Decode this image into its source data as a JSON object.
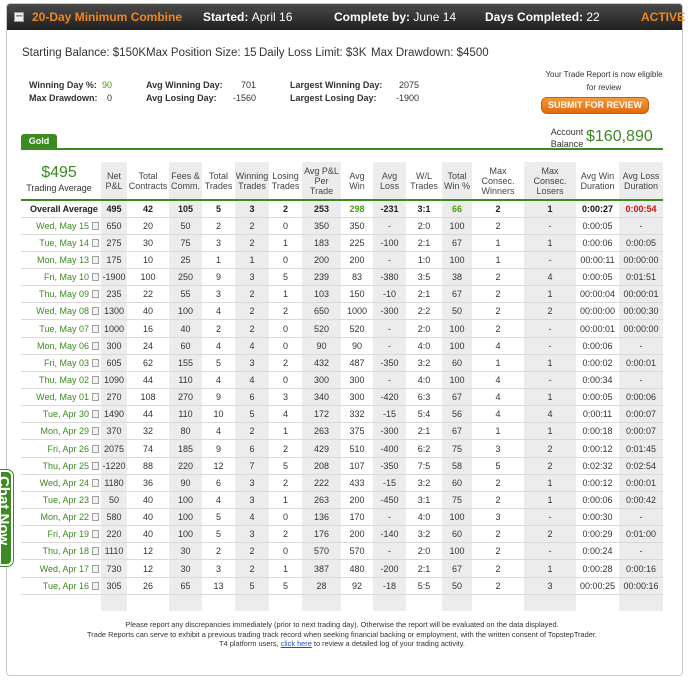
{
  "header": {
    "toggle": "−",
    "combine": "20-Day Minimum Combine",
    "started_label": "Started:",
    "started_value": "April 16",
    "complete_label": "Complete by:",
    "complete_value": "June 14",
    "days_label": "Days Completed:",
    "days_value": "22",
    "status": "ACTIVE"
  },
  "summary": {
    "starting_balance": "Starting Balance: $150K",
    "max_position": "Max Position Size: 15",
    "daily_loss": "Daily Loss Limit: $3K",
    "max_drawdown": "Max Drawdown: $4500"
  },
  "stats": {
    "winning_day_pct_label": "Winning Day %:",
    "winning_day_pct": "90",
    "max_drawdown_label": "Max Drawdown:",
    "max_drawdown": "0",
    "avg_winning_day_label": "Avg Winning Day:",
    "avg_winning_day": "701",
    "avg_losing_day_label": "Avg Losing Day:",
    "avg_losing_day": "-1560",
    "largest_winning_day_label": "Largest Winning Day:",
    "largest_winning_day": "2075",
    "largest_losing_day_label": "Largest Losing Day:",
    "largest_losing_day": "-1900"
  },
  "report": {
    "note": "Your Trade Report is now eligible for review",
    "submit_label": "SUBMIT FOR REVIEW"
  },
  "account": {
    "tab": "Gold",
    "balance_label": "Account Balance",
    "balance_value": "$160,890",
    "trading_average_value": "$495",
    "trading_average_label": "Trading Average"
  },
  "columns": [
    "Net P&L",
    "Total Contracts",
    "Fees & Comm.",
    "Total Trades",
    "Winning Trades",
    "Losing Trades",
    "Avg P&L Per Trade",
    "Avg Win",
    "Avg Loss",
    "W/L Trades",
    "Total Win %",
    "Max Consec. Winners",
    "Max Consec. Losers",
    "Avg Win Duration",
    "Avg Loss Duration"
  ],
  "overall": [
    "Overall Average",
    "495",
    "42",
    "105",
    "5",
    "3",
    "2",
    "253",
    "298",
    "-231",
    "3:1",
    "66",
    "2",
    "1",
    "0:00:27",
    "0:00:54"
  ],
  "rows": [
    [
      "Wed, May 15",
      "650",
      "20",
      "50",
      "2",
      "2",
      "0",
      "350",
      "350",
      "-",
      "2:0",
      "100",
      "2",
      "-",
      "0:00:05",
      "-"
    ],
    [
      "Tue, May 14",
      "275",
      "30",
      "75",
      "3",
      "2",
      "1",
      "183",
      "225",
      "-100",
      "2:1",
      "67",
      "1",
      "1",
      "0:00:06",
      "0:00:05"
    ],
    [
      "Mon, May 13",
      "175",
      "10",
      "25",
      "1",
      "1",
      "0",
      "200",
      "200",
      "-",
      "1:0",
      "100",
      "1",
      "-",
      "00:00:11",
      "00:00:00"
    ],
    [
      "Fri, May 10",
      "-1900",
      "100",
      "250",
      "9",
      "3",
      "5",
      "239",
      "83",
      "-380",
      "3:5",
      "38",
      "2",
      "4",
      "0:00:05",
      "0:01:51"
    ],
    [
      "Thu, May 09",
      "235",
      "22",
      "55",
      "3",
      "2",
      "1",
      "103",
      "150",
      "-10",
      "2:1",
      "67",
      "2",
      "1",
      "00:00:04",
      "00:00:01"
    ],
    [
      "Wed, May 08",
      "1300",
      "40",
      "100",
      "4",
      "2",
      "2",
      "650",
      "1000",
      "-300",
      "2:2",
      "50",
      "2",
      "2",
      "00:00:00",
      "00:00:30"
    ],
    [
      "Tue, May 07",
      "1000",
      "16",
      "40",
      "2",
      "2",
      "0",
      "520",
      "520",
      "-",
      "2:0",
      "100",
      "2",
      "-",
      "00:00:01",
      "00:00:00"
    ],
    [
      "Mon, May 06",
      "300",
      "24",
      "60",
      "4",
      "4",
      "0",
      "90",
      "90",
      "-",
      "4:0",
      "100",
      "4",
      "-",
      "0:00:06",
      "-"
    ],
    [
      "Fri, May 03",
      "605",
      "62",
      "155",
      "5",
      "3",
      "2",
      "432",
      "487",
      "-350",
      "3:2",
      "60",
      "1",
      "1",
      "0:00:02",
      "0:00:01"
    ],
    [
      "Thu, May 02",
      "1090",
      "44",
      "110",
      "4",
      "4",
      "0",
      "300",
      "300",
      "-",
      "4:0",
      "100",
      "4",
      "-",
      "0:00:34",
      "-"
    ],
    [
      "Wed, May 01",
      "270",
      "108",
      "270",
      "9",
      "6",
      "3",
      "340",
      "300",
      "-420",
      "6:3",
      "67",
      "4",
      "1",
      "0:00:05",
      "0:00:06"
    ],
    [
      "Tue, Apr 30",
      "1490",
      "44",
      "110",
      "10",
      "5",
      "4",
      "172",
      "332",
      "-15",
      "5:4",
      "56",
      "4",
      "4",
      "0:00:11",
      "0:00:07"
    ],
    [
      "Mon, Apr 29",
      "370",
      "32",
      "80",
      "4",
      "2",
      "1",
      "263",
      "375",
      "-300",
      "2:1",
      "67",
      "1",
      "1",
      "0:00:18",
      "0:00:07"
    ],
    [
      "Fri, Apr 26",
      "2075",
      "74",
      "185",
      "9",
      "6",
      "2",
      "429",
      "510",
      "-400",
      "6:2",
      "75",
      "3",
      "2",
      "0:00:12",
      "0:01:45"
    ],
    [
      "Thu, Apr 25",
      "-1220",
      "88",
      "220",
      "12",
      "7",
      "5",
      "208",
      "107",
      "-350",
      "7:5",
      "58",
      "5",
      "2",
      "0:02:32",
      "0:02:54"
    ],
    [
      "Wed, Apr 24",
      "1180",
      "36",
      "90",
      "6",
      "3",
      "2",
      "222",
      "433",
      "-15",
      "3:2",
      "60",
      "2",
      "1",
      "0:00:12",
      "0:00:01"
    ],
    [
      "Tue, Apr 23",
      "50",
      "40",
      "100",
      "4",
      "3",
      "1",
      "263",
      "200",
      "-450",
      "3:1",
      "75",
      "2",
      "1",
      "0:00:06",
      "0:00:42"
    ],
    [
      "Mon, Apr 22",
      "580",
      "40",
      "100",
      "5",
      "4",
      "0",
      "136",
      "170",
      "-",
      "4:0",
      "100",
      "3",
      "-",
      "0:00:30",
      "-"
    ],
    [
      "Fri, Apr 19",
      "220",
      "40",
      "100",
      "5",
      "3",
      "2",
      "176",
      "200",
      "-140",
      "3:2",
      "60",
      "2",
      "2",
      "0:00:29",
      "0:01:00"
    ],
    [
      "Thu, Apr 18",
      "1110",
      "12",
      "30",
      "2",
      "2",
      "0",
      "570",
      "570",
      "-",
      "2:0",
      "100",
      "2",
      "-",
      "0:00:24",
      "-"
    ],
    [
      "Wed, Apr 17",
      "730",
      "12",
      "30",
      "3",
      "2",
      "1",
      "387",
      "480",
      "-200",
      "2:1",
      "67",
      "2",
      "1",
      "0:00:28",
      "0:00:16"
    ],
    [
      "Tue, Apr 16",
      "305",
      "26",
      "65",
      "13",
      "5",
      "5",
      "28",
      "92",
      "-18",
      "5:5",
      "50",
      "2",
      "3",
      "00:00:25",
      "00:00:16"
    ]
  ],
  "footer": {
    "line1": "Please report any discrepancies immediately (prior to next trading day). Otherwise the report will be evaluated on the data displayed.",
    "line2": "Trade Reports can serve to exhibit a previous trading track record when seeking financial backing or employment, with the written consent of TopstepTrader.",
    "line3_pre": "T4 platform users,",
    "line3_link": "click here",
    "line3_post": "to review a detailed log of your trading activity."
  },
  "chat": {
    "label": "Chat Now"
  }
}
